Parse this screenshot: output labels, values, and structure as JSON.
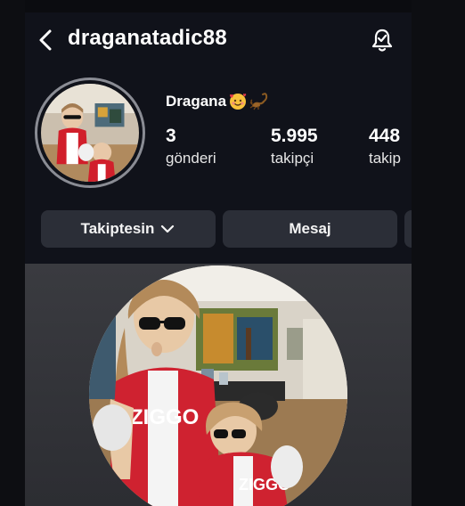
{
  "header": {
    "username": "draganatadic88",
    "back_icon": "chevron-left-icon",
    "notify_icon": "bell-icon"
  },
  "profile": {
    "display_name": "Dragana",
    "name_emojis": [
      "smiling-face-with-hearts-emoji",
      "scorpion-emoji"
    ],
    "stats": [
      {
        "value": "3",
        "label": "gönderi"
      },
      {
        "value": "5.995",
        "label": "takipçi"
      },
      {
        "value": "448",
        "label": "takip"
      }
    ]
  },
  "actions": {
    "following_label": "Takiptesin",
    "message_label": "Mesaj"
  },
  "colors": {
    "background": "#10121a",
    "button": "#2b2e37",
    "jersey_red": "#d11f2b"
  }
}
